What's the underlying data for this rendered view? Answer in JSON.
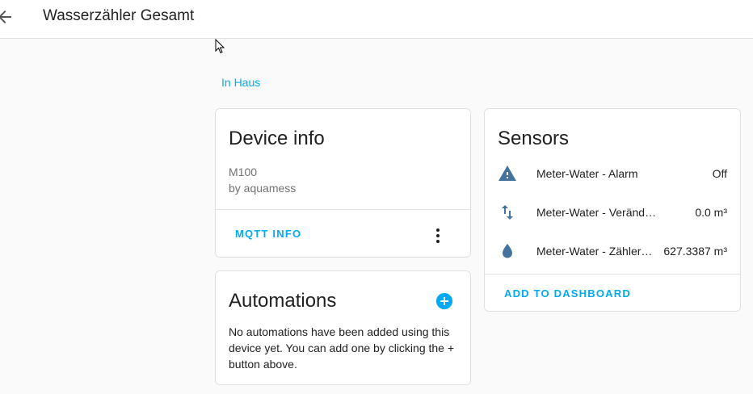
{
  "header": {
    "title": "Wasserzähler Gesamt"
  },
  "area": {
    "label": "In Haus"
  },
  "device_info": {
    "title": "Device info",
    "model": "M100",
    "manufacturer": "by aquamess",
    "mqtt_button": "MQTT INFO"
  },
  "sensors": {
    "title": "Sensors",
    "items": [
      {
        "name": "Meter-Water - Alarm",
        "value": "Off",
        "icon": "alert-icon"
      },
      {
        "name": "Meter-Water - Veränderung",
        "value": "0.0 m³",
        "icon": "swap-vertical-icon"
      },
      {
        "name": "Meter-Water - Zählerstand",
        "display_name": "Meter-Water - Zählers…",
        "value": "627.3387 m³",
        "icon": "water-drop-icon"
      }
    ],
    "add_button": "ADD TO DASHBOARD"
  },
  "automations": {
    "title": "Automations",
    "empty_text": "No automations have been added using this device yet. You can add one by clicking the + button above."
  },
  "colors": {
    "accent": "#03a9f4",
    "icon": "#44739e",
    "divider": "#e0e0e0"
  }
}
